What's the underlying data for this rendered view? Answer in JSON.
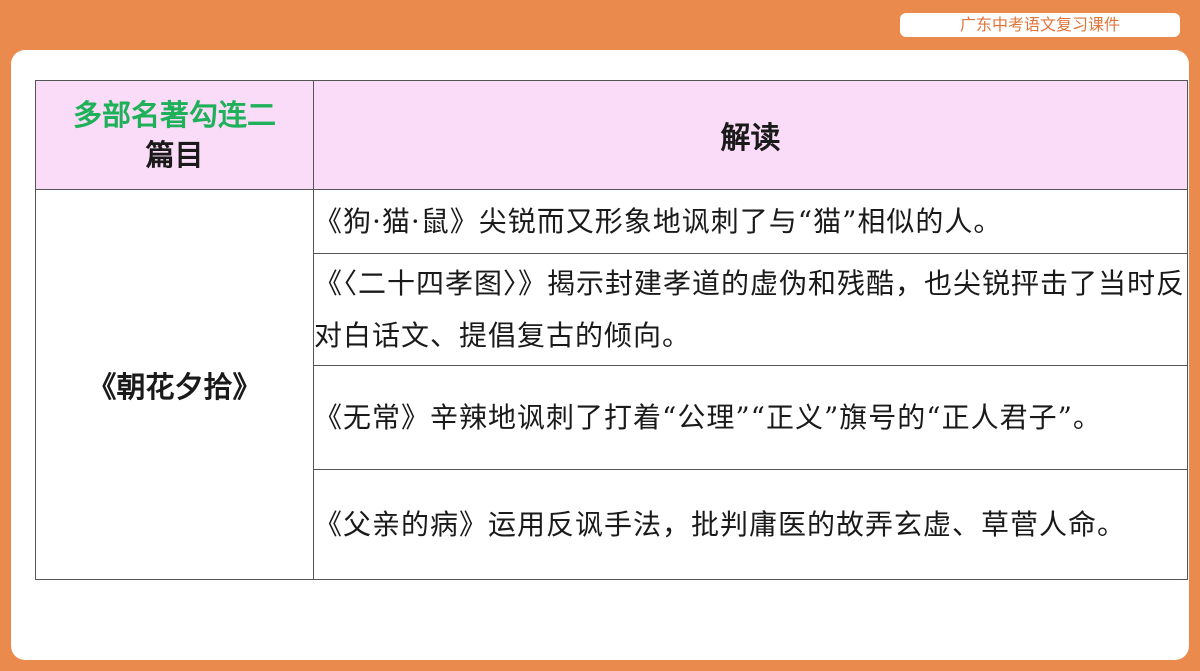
{
  "header": {
    "course_label": "广东中考语文复习课件"
  },
  "table": {
    "header_left_title": "多部名著勾连二",
    "header_left_sub": "篇目",
    "header_right": "解读",
    "book": "《朝花夕拾》",
    "rows": [
      "《狗·猫·鼠》尖锐而又形象地讽刺了与“猫”相似的人。",
      "《〈二十四孝图〉》揭示封建孝道的虚伪和残酷，也尖锐抨击了当时反对白话文、提倡复古的倾向。",
      "《无常》辛辣地讽刺了打着“公理”“正义”旗号的“正人君子”。",
      "《父亲的病》运用反讽手法，批判庸医的故弄玄虚、草菅人命。"
    ]
  },
  "colors": {
    "frame": "#ea8a4c",
    "header_bg": "#fadcf8",
    "title_green": "#1fb15a"
  }
}
